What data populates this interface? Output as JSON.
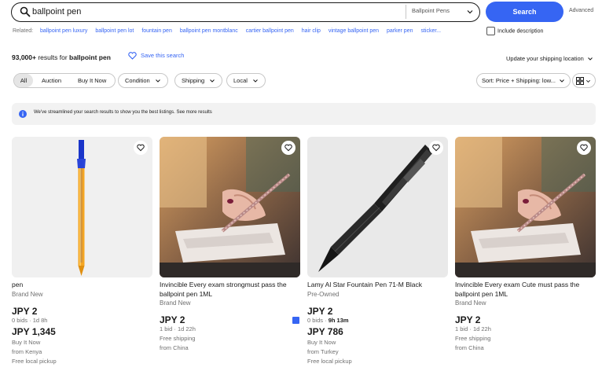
{
  "search": {
    "query": "ballpoint pen",
    "category": "Ballpoint Pens",
    "button_label": "Search",
    "advanced_label": "Advanced"
  },
  "related": {
    "label": "Related:",
    "links": [
      "ballpoint pen luxury",
      "ballpoint pen lot",
      "fountain pen",
      "ballpoint pen montblanc",
      "cartier ballpoint pen",
      "hair clip",
      "vintage ballpoint pen",
      "parker pen",
      "sticker..."
    ],
    "include_description_label": "Include description"
  },
  "results": {
    "count": "93,000+",
    "middle": " results for ",
    "query": "ballpoint pen",
    "save_search_label": "Save this search",
    "shipping_location_label": "Update your shipping location"
  },
  "filters": {
    "format_tabs": [
      "All",
      "Auction",
      "Buy It Now"
    ],
    "condition_label": "Condition",
    "shipping_label": "Shipping",
    "local_label": "Local",
    "sort_label": "Sort: Price + Shipping: low..."
  },
  "banner": {
    "message": "We've streamlined your search results to show you the best listings. See more results"
  },
  "listings": [
    {
      "title": "pen",
      "condition": "Brand New",
      "price": "JPY 2",
      "bids": "0 bids",
      "time_left": "1d 8h",
      "buy_now_price": "JPY 1,345",
      "buy_now_label": "Buy It Now",
      "shipping_from": "from Kenya",
      "pickup": "Free local pickup",
      "image": "orange-ballpoint-pen"
    },
    {
      "title": "Invincible Every exam strongmust pass the ballpoint pen 1ML",
      "condition": "Brand New",
      "price": "JPY 2",
      "bids": "1 bid",
      "time_left": "1d 22h",
      "shipping": "Free shipping",
      "shipping_from": "from China",
      "image": "hand-writing-with-pen"
    },
    {
      "title": "Lamy Al Star Fountain Pen 71-M Black",
      "condition": "Pre-Owned",
      "price": "JPY 2",
      "bids": "0 bids",
      "time_left": "9h 13m",
      "buy_now_price": "JPY 786",
      "buy_now_label": "Buy It Now",
      "shipping_from": "from Turkey",
      "pickup": "Free local pickup",
      "image": "black-fountain-pen"
    },
    {
      "title": "Invincible Every exam Cute must pass the ballpoint pen 1ML",
      "condition": "Brand New",
      "price": "JPY 2",
      "bids": "1 bid",
      "time_left": "1d 22h",
      "shipping": "Free shipping",
      "shipping_from": "from China",
      "image": "hand-writing-with-pen"
    }
  ],
  "colors": {
    "accent": "#3665f3",
    "text": "#191919",
    "muted": "#707070",
    "banner_bg": "#f2f2f2"
  }
}
